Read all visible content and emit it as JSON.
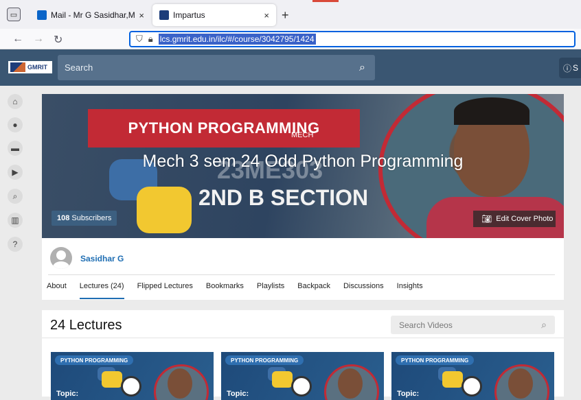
{
  "browser": {
    "tabs": [
      {
        "title": "Mail - Mr G Sasidhar,Mech - Ou",
        "close": "×",
        "active": false,
        "favicon_color": "#0a64c8"
      },
      {
        "title": "Impartus",
        "close": "×",
        "active": true,
        "favicon_color": "#1d3d7a"
      }
    ],
    "new_tab": "+",
    "url": "lcs.gmrit.edu.in/ilc/#/course/3042795/1424"
  },
  "app": {
    "logo_text": "GMRIT",
    "search_placeholder": "Search",
    "help_label": "S"
  },
  "cover": {
    "banner_text": "PYTHON PROGRAMMING",
    "small_label": "MECH",
    "code_text": "23ME303",
    "section_text": "2ND B SECTION",
    "course_title": "Mech 3 sem 24 Odd Python Programming",
    "subscribers_count": "108",
    "subscribers_label": "Subscribers",
    "edit_cover": "Edit Cover Photo"
  },
  "owner": {
    "name": "Sasidhar G"
  },
  "course_tabs": [
    {
      "label": "About",
      "active": false
    },
    {
      "label": "Lectures (24)",
      "active": true
    },
    {
      "label": "Flipped Lectures",
      "active": false
    },
    {
      "label": "Bookmarks",
      "active": false
    },
    {
      "label": "Playlists",
      "active": false
    },
    {
      "label": "Backpack",
      "active": false
    },
    {
      "label": "Discussions",
      "active": false
    },
    {
      "label": "Insights",
      "active": false
    }
  ],
  "lectures": {
    "heading": "24 Lectures",
    "search_placeholder": "Search Videos",
    "cards": [
      {
        "pill": "PYTHON PROGRAMMING",
        "topic": "Topic:"
      },
      {
        "pill": "PYTHON PROGRAMMING",
        "topic": "Topic:"
      },
      {
        "pill": "PYTHON PROGRAMMING",
        "topic": "Topic:"
      }
    ]
  },
  "sidebar": {
    "icons": [
      "home-icon",
      "classroom-icon",
      "folder-icon",
      "video-library-icon",
      "search-icon",
      "analytics-icon",
      "help-icon"
    ]
  },
  "colors": {
    "header": "#3a5672",
    "accent": "#1f6eb3",
    "banner_red": "#c22a35"
  }
}
